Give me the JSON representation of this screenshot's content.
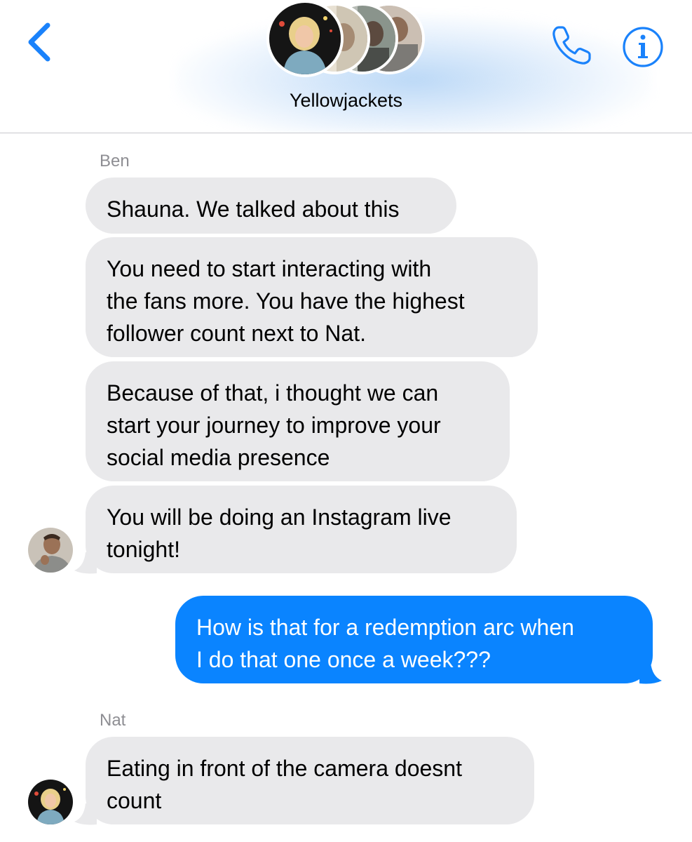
{
  "header": {
    "group_name": "Yellowjackets",
    "back_icon": "chevron-left-icon",
    "call_icon": "phone-icon",
    "info_icon": "info-icon",
    "accent_color": "#1a82fb"
  },
  "colors": {
    "incoming_bubble": "#e9e9eb",
    "outgoing_bubble": "#0a84ff",
    "sender_label": "#8e8e93"
  },
  "messages": [
    {
      "sender": "Ben"
    },
    {
      "lines": [
        "Shauna. We talked about this"
      ]
    },
    {
      "lines": [
        "You need to start interacting with",
        "the fans more. You have the highest",
        "follower count next to Nat."
      ]
    },
    {
      "lines": [
        "Because of that, i thought we can",
        "start your journey to improve your",
        "social media presence"
      ]
    },
    {
      "lines": [
        "You will be doing an Instagram live",
        "tonight!"
      ]
    },
    {
      "lines": [
        "How is that for a redemption arc when",
        "I do that one once a week???"
      ]
    },
    {
      "sender": "Nat"
    },
    {
      "lines": [
        "Eating in front of the camera doesnt",
        "count"
      ]
    }
  ]
}
